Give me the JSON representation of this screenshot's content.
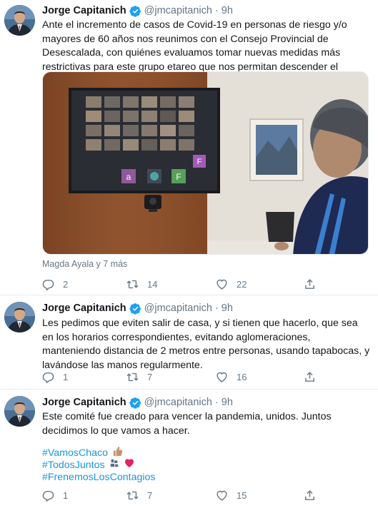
{
  "tweets": [
    {
      "author_name": "Jorge Capitanich",
      "handle": "@jmcapitanich",
      "dot": "·",
      "time": "9h",
      "text": "Ante el incremento de casos de Covid-19 en personas de riesgo y/o mayores de 60 años nos reunimos con el Consejo Provincial de Desescalada, con quiénes evaluamos tomar nuevas medidas más restrictivas para este grupo etareo que nos permitan descender el número de contagios.",
      "media_caption": "Magda Ayala y 7 más",
      "video_tiles": [
        "a",
        "F",
        "F"
      ],
      "replies": "2",
      "retweets": "14",
      "likes": "22"
    },
    {
      "author_name": "Jorge Capitanich",
      "handle": "@jmcapitanich",
      "dot": "·",
      "time": "9h",
      "text": "Les pedimos que eviten salir de casa, y si tienen que hacerlo, que sea en los horarios correspondientes, evitando aglomeraciones, manteniendo distancia de 2 metros entre personas, usando tapabocas, y lavándose las manos regularmente.",
      "replies": "1",
      "retweets": "7",
      "likes": "16"
    },
    {
      "author_name": "Jorge Capitanich",
      "handle": "@jmcapitanich",
      "dot": "·",
      "time": "9h",
      "text": "Este comité fue creado para vencer la pandemia, unidos. Juntos decidimos lo que vamos a hacer.",
      "hashtags": [
        "#VamosChaco",
        "#TodosJuntos",
        "#FrenemosLosContagios"
      ],
      "replies": "1",
      "retweets": "7",
      "likes": "15"
    }
  ],
  "icons": {
    "verified": "verified-badge-icon",
    "reply": "reply-icon",
    "retweet": "retweet-icon",
    "like": "heart-icon",
    "share": "share-icon"
  },
  "colors": {
    "accent": "#1da1f2",
    "hashtag": "#1b95e0",
    "secondary_text": "#657786",
    "divider": "#e6ecf0"
  }
}
